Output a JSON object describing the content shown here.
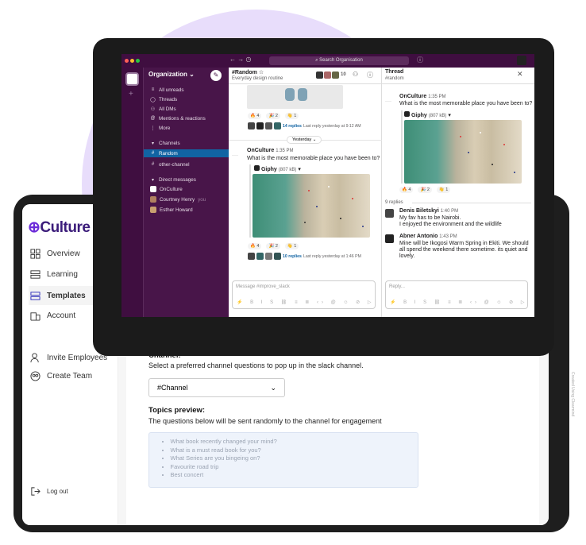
{
  "watermark": "Created Using Clearmind",
  "tablet": {
    "logo_on": "On",
    "logo_culture": "Culture",
    "nav": [
      {
        "label": "Overview"
      },
      {
        "label": "Learning"
      },
      {
        "label": "Templates"
      },
      {
        "label": "Account"
      }
    ],
    "nav2": [
      {
        "label": "Invite Employees"
      },
      {
        "label": "Create Team"
      }
    ],
    "logout": "Log out",
    "channel_heading": "Channel:",
    "channel_desc": "Select a preferred channel questions to pop up in the slack channel.",
    "channel_value": "#Channel",
    "topics_heading": "Topics preview:",
    "topics_desc": "The questions below will be sent randomly to the channel for engagement",
    "topics": [
      "What book recently changed your mind?",
      "What is a must read book for you?",
      "What Series are you bingeing on?",
      "Favourite road trip",
      "Best concert"
    ]
  },
  "slack": {
    "search_placeholder": "Search Organisation",
    "workspace": "Organization",
    "nav": [
      "All unreads",
      "Threads",
      "All DMs",
      "Mentions & reactions",
      "More"
    ],
    "channels_header": "Channels",
    "channels": [
      "Random",
      "other-channel"
    ],
    "dm_header": "Direct messages",
    "dms": [
      {
        "name": "OnCulture",
        "you": ""
      },
      {
        "name": "Courtney Henry",
        "you": "you"
      },
      {
        "name": "Esther Howard",
        "you": ""
      }
    ],
    "channel": {
      "name": "#Random",
      "topic": "Everyday design routine",
      "members": "10",
      "replies1": "14 replies",
      "last1": "Last reply yesterday at 9:12 AM",
      "divider": "Yesterday",
      "author": "OnCulture",
      "time": "1:35 PM",
      "text": "What is the most memorable place you have been to?",
      "attachment": "Giphy",
      "attachment_size": "(807 kB)",
      "r1": "4",
      "r2": "2",
      "r3": "1",
      "replies2": "10 replies",
      "last2": "Last reply yesterday at 1:46 PM",
      "input_placeholder": "Message #improve_slack"
    },
    "thread": {
      "title": "Thread",
      "channel": "#random",
      "author": "OnCulture",
      "time": "1:35 PM",
      "text": "What is the most memorable place you have been to?",
      "attachment": "Giphy",
      "attachment_size": "(807 kB)",
      "reply_count": "9 replies",
      "replies": [
        {
          "author": "Denis Biletskyi",
          "time": "1:40 PM",
          "text": "My fav has to be Nairobi.\nI enjoyed the environment and the wildlife"
        },
        {
          "author": "Abner Antonio",
          "time": "1:43 PM",
          "text": "Mine will be Ikogosi Warm Spring in Ekiti. We should all spend the weekend there sometime. its quiet and lovely."
        }
      ],
      "reply_placeholder": "Reply..."
    }
  }
}
